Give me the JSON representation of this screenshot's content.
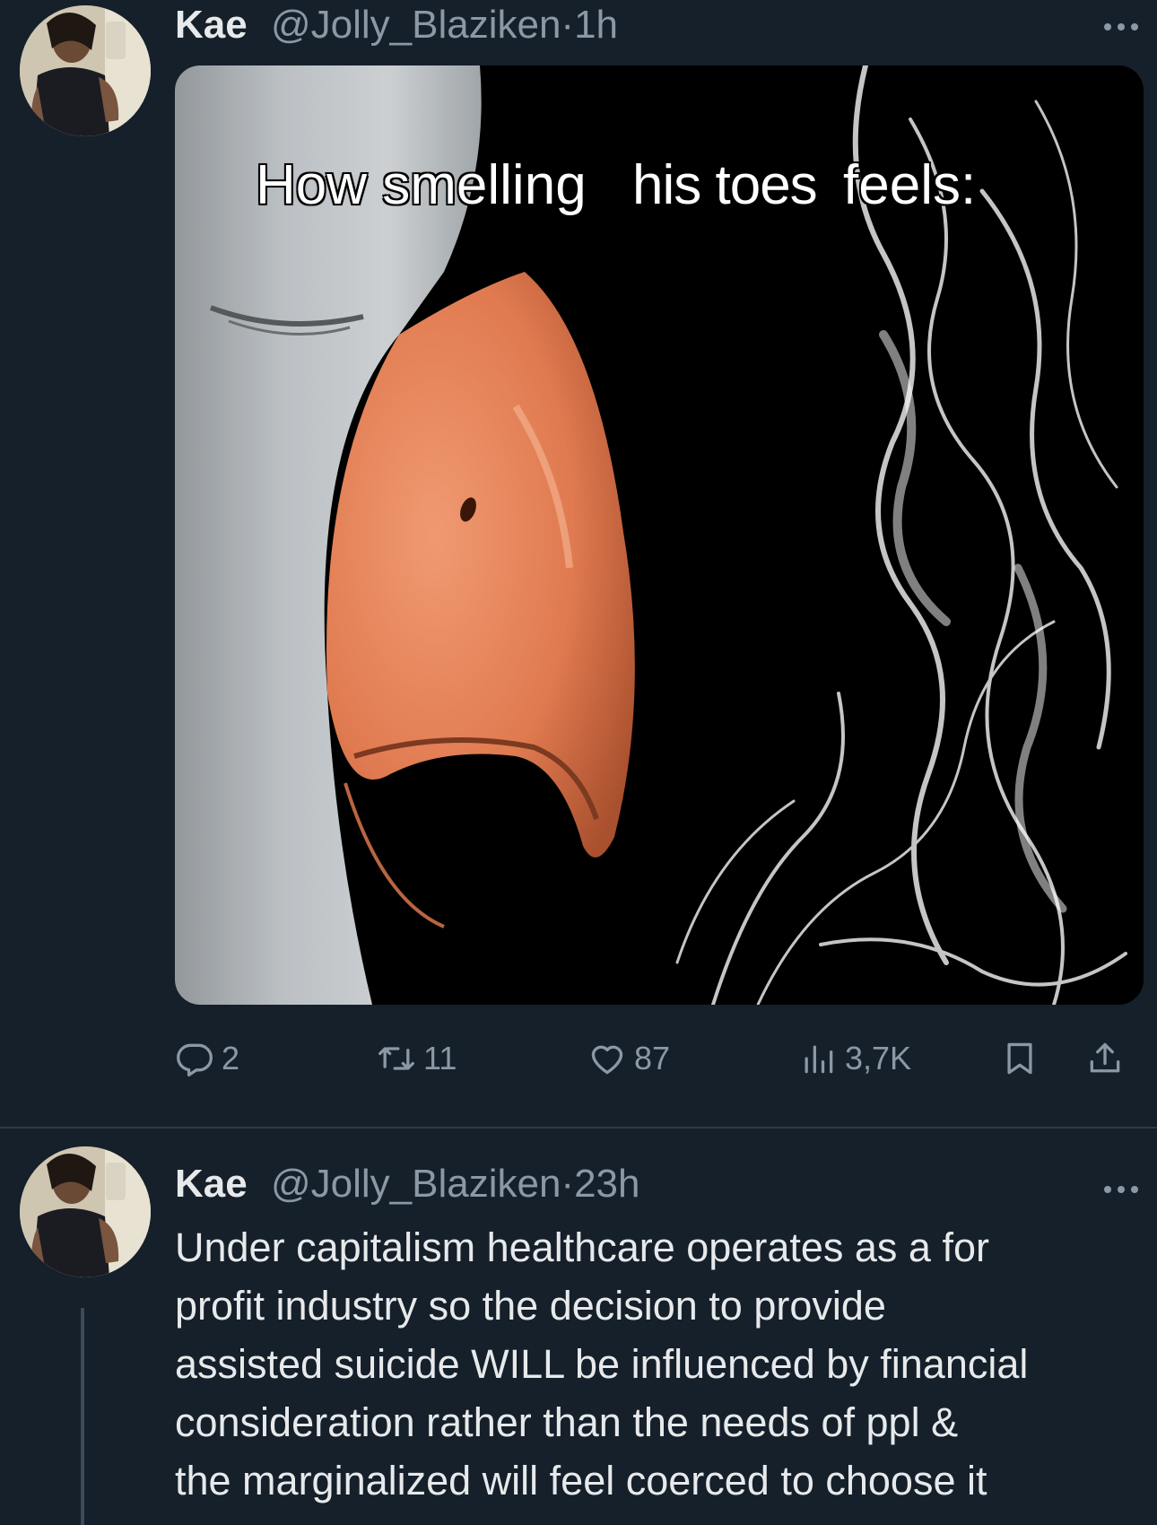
{
  "tweets": [
    {
      "author_name": "Kae",
      "handle": "@Jolly_Blaziken",
      "separator": "·",
      "time": "1h",
      "media": {
        "caption_parts": [
          "How smelling",
          "his toes",
          "feels:"
        ]
      },
      "actions": {
        "replies": "2",
        "retweets": "11",
        "likes": "87",
        "views": "3,7K"
      }
    },
    {
      "author_name": "Kae",
      "handle": "@Jolly_Blaziken",
      "separator": "·",
      "time": "23h",
      "text_lines": [
        "Under capitalism healthcare operates as a for",
        "profit industry so the decision to provide",
        "assisted suicide WILL be influenced by financial",
        "consideration rather than the needs of ppl &",
        "the marginalized will feel coerced to choose it"
      ]
    }
  ],
  "colors": {
    "background": "#15202b",
    "text_primary": "#e7e9ea",
    "text_secondary": "#8b98a5",
    "divider": "#2f3b47"
  },
  "icons": {
    "more": "more-horizontal-icon",
    "reply": "reply-icon",
    "retweet": "retweet-icon",
    "like": "heart-icon",
    "views": "views-chart-icon",
    "bookmark": "bookmark-icon",
    "share": "share-icon"
  }
}
